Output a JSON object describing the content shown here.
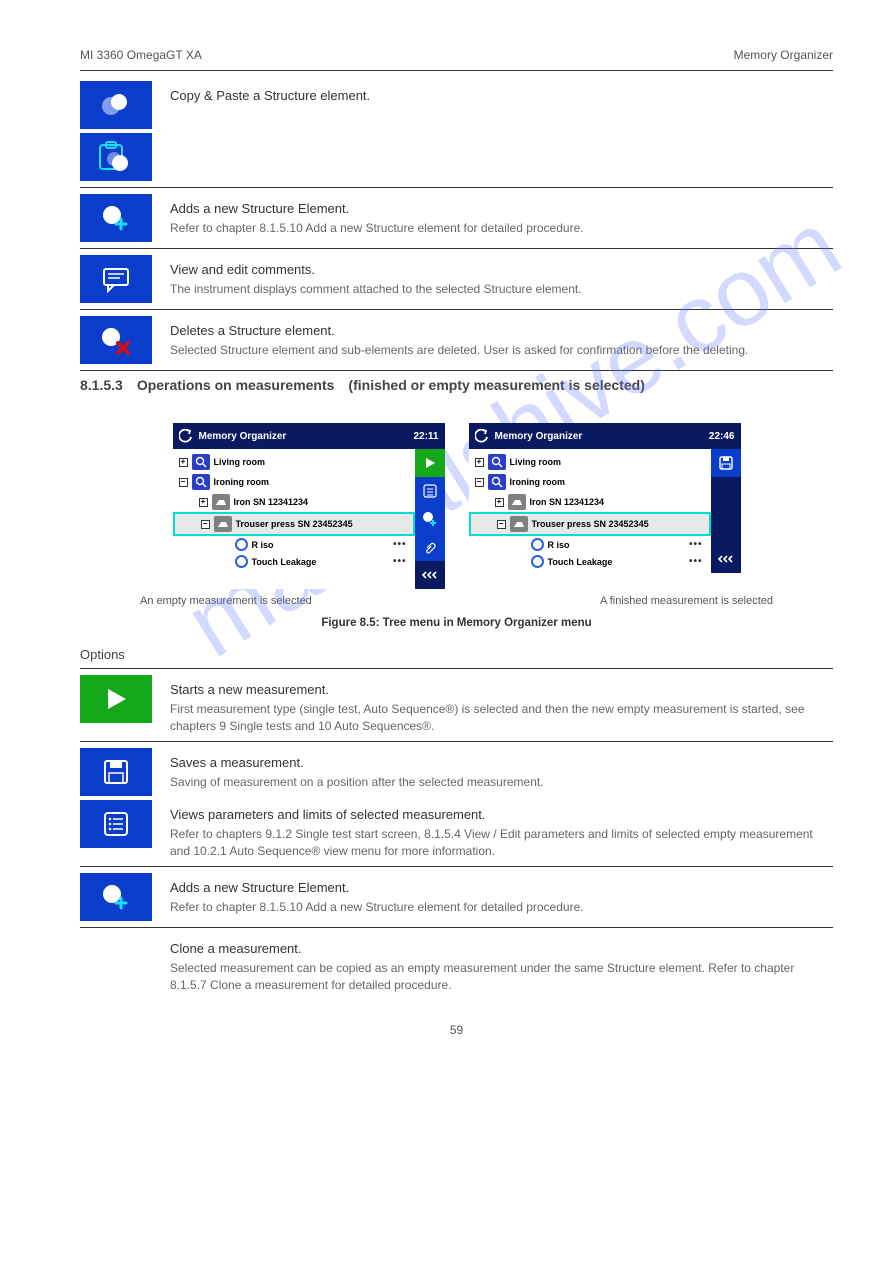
{
  "header": {
    "left": "MI 3360 OmegaGT XA",
    "right": "Memory Organizer"
  },
  "watermark": "manualshive.com",
  "blocks1": [
    {
      "icons": [
        "copy-paste",
        "clipboard-copy"
      ],
      "text": "Copy & Paste a Structure element.",
      "sub": ""
    },
    {
      "icons": [
        "add-structure"
      ],
      "text": "Adds a new Structure Element.",
      "sub": "Refer to chapter 8.1.5.10 Add a new Structure element for detailed procedure."
    },
    {
      "icons": [
        "comment"
      ],
      "text": "View and edit comments.",
      "sub": "The instrument displays comment attached to the selected Structure element."
    },
    {
      "icons": [
        "delete-structure"
      ],
      "text": "Deletes a Structure element.",
      "sub": "Selected Structure element and sub-elements are deleted. User is asked for confirmation before the deleting."
    }
  ],
  "section_heading": "8.1.5.3 Operations on measurements (finished or empty measurement is selected)",
  "panel": {
    "title": "Memory Organizer",
    "times": [
      "22:11",
      "22:46"
    ],
    "tree": {
      "living": "Living room",
      "ironing": "Ironing room",
      "iron": "Iron SN 12341234",
      "trouser": "Trouser press SN 23452345",
      "riso": "R iso",
      "touch": "Touch Leakage"
    }
  },
  "caption_left": "An empty measurement is selected",
  "caption_right": "A finished measurement is selected",
  "figure_caption": "Figure 8.5: Tree menu in Memory Organizer menu",
  "options": "Options",
  "blocks2": [
    {
      "icon": "play",
      "text": "Starts a new measurement.",
      "sub": "First measurement type (single test, Auto Sequence®) is selected and then the new empty measurement is started, see chapters 9 Single tests and 10 Auto Sequences®."
    },
    {
      "icon": "save",
      "text": "Saves a measurement.",
      "sub": "Saving of measurement on a position after the selected measurement."
    },
    {
      "icon": "params",
      "text": "Views parameters and limits of selected measurement.",
      "sub": "Refer to chapters 9.1.2 Single test start screen, 8.1.5.4 View / Edit parameters and limits of selected empty measurement and 10.2.1 Auto Sequence® view menu for more information."
    },
    {
      "icon": "add-structure",
      "text": "Adds a new Structure Element.",
      "sub": "Refer to chapter 8.1.5.10 Add a new Structure element for detailed procedure."
    },
    {
      "icon": "none",
      "text": "Clone a measurement.",
      "sub": "Selected measurement can be copied as an empty measurement under the same Structure element. Refer to chapter 8.1.5.7 Clone a measurement for detailed procedure."
    }
  ],
  "page_number": "59"
}
